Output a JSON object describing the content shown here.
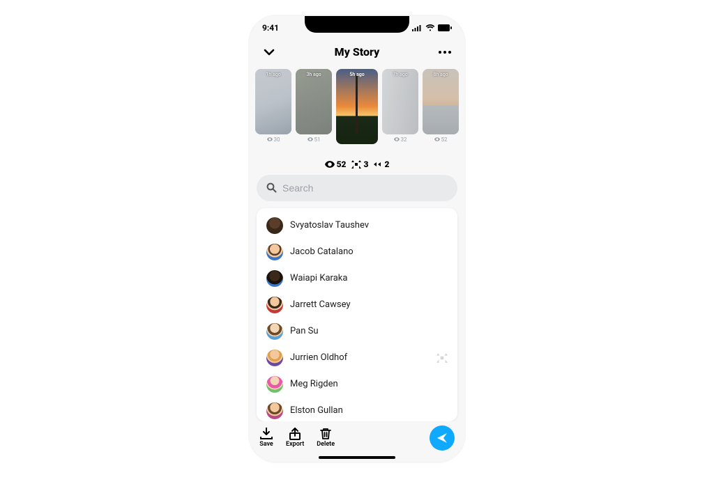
{
  "status": {
    "time": "9:41"
  },
  "header": {
    "title": "My Story"
  },
  "stories": [
    {
      "ago": "1h ago",
      "views": "30"
    },
    {
      "ago": "3h ago",
      "views": "51"
    },
    {
      "ago": "5h ago",
      "views": "52",
      "selected": true
    },
    {
      "ago": "7h ago",
      "views": "32"
    },
    {
      "ago": "8h ago",
      "views": "52"
    }
  ],
  "metrics": {
    "views": "52",
    "screenshots": "3",
    "replays": "2"
  },
  "search": {
    "placeholder": "Search"
  },
  "viewers": [
    {
      "name": "Svyatoslav Taushev"
    },
    {
      "name": "Jacob Catalano"
    },
    {
      "name": "Waiapi Karaka"
    },
    {
      "name": "Jarrett Cawsey"
    },
    {
      "name": "Pan Su"
    },
    {
      "name": "Jurrien Oldhof",
      "screenshot": true
    },
    {
      "name": "Meg Rigden"
    },
    {
      "name": "Elston Gullan"
    }
  ],
  "bottombar": {
    "save": "Save",
    "export": "Export",
    "delete": "Delete"
  }
}
